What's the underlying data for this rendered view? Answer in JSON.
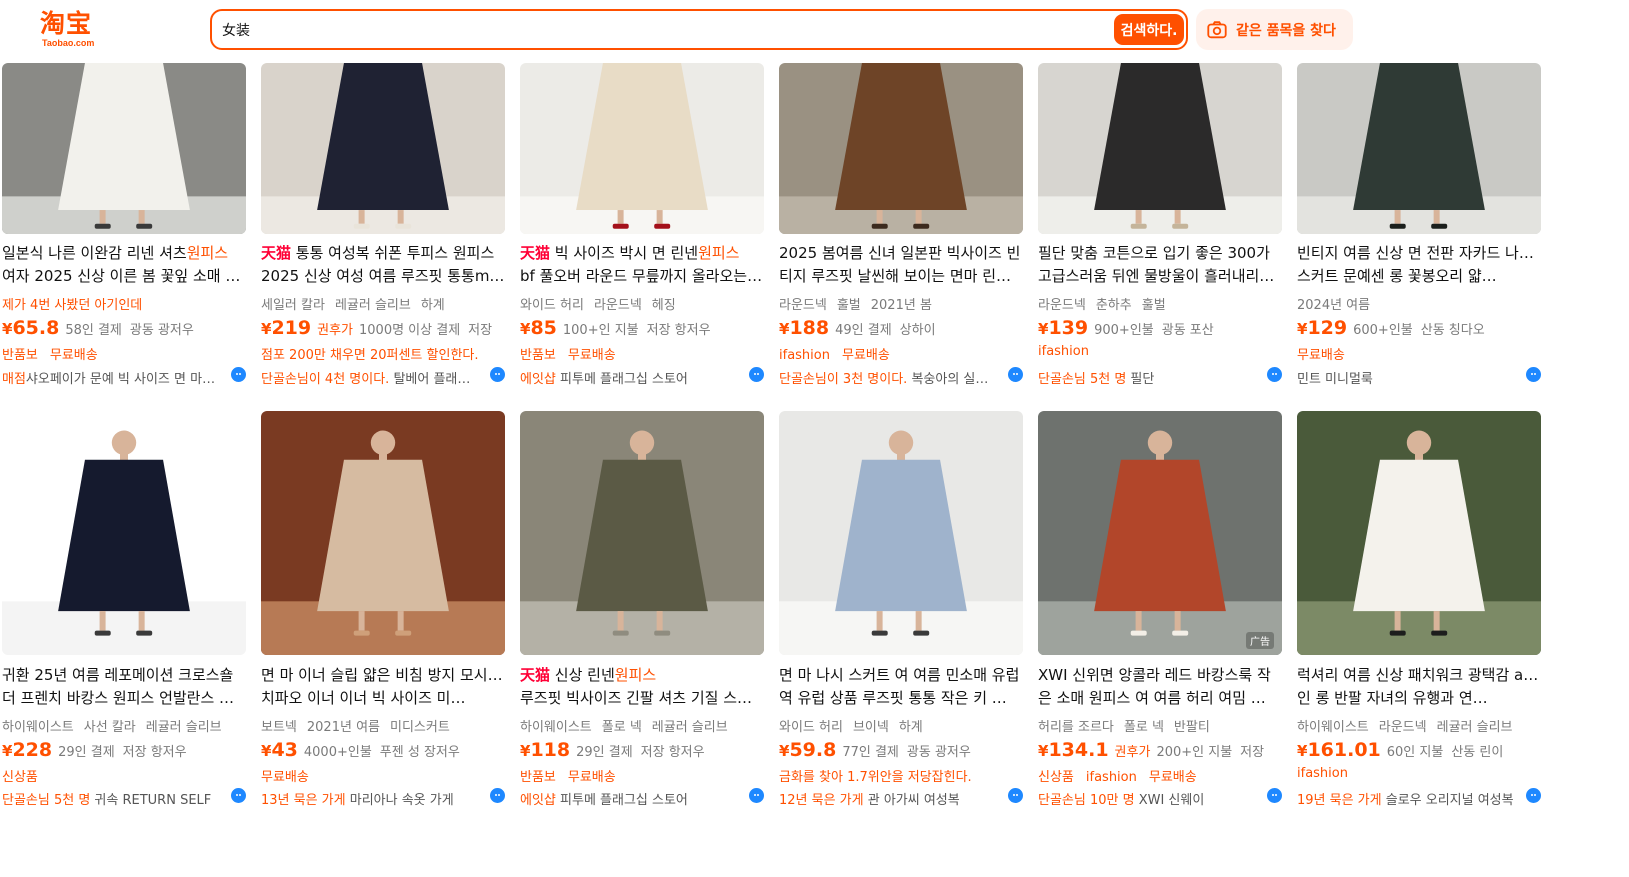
{
  "header": {
    "logo_text": "淘宝",
    "logo_sub": "Taobao.com",
    "search_value": "女装",
    "search_button": "검색하다.",
    "same_item_button": "같은 품목을 찾다"
  },
  "products": [
    {
      "title_prefix": "",
      "title_parts": [
        "일본식 나른 이완감 리넨 셔츠",
        "원피스",
        "여자 2025 신상 이른 봄 꽃잎 소매 …"
      ],
      "tags": [
        "제가 4번 사봤던 아기인데"
      ],
      "tags_warm": true,
      "price": "65.8",
      "after_coupon": "",
      "meta": [
        "58인 결제",
        "광동 광저우"
      ],
      "promos": [
        "반품보",
        "무료배송"
      ],
      "shop_badge": "매점",
      "shop_name": "샤오페이가 문예 빅 사이즈 면 마…"
    },
    {
      "title_prefix": "天猫",
      "title_parts": [
        " 통통 여성복 쉬폰 투피스 원피스",
        "",
        "2025 신상 여성 여름 루즈핏 통통m…"
      ],
      "tags": [
        "세일러 칼라",
        "레귤러 슬리브",
        "하계"
      ],
      "tags_warm": false,
      "price": "219",
      "after_coupon": "권후가",
      "meta": [
        "1000명 이상 결제",
        "저장"
      ],
      "promos": [
        "점포 200만 채우면 20퍼센트 할인한다."
      ],
      "shop_badge": "단골손님이 4천 명이다.",
      "shop_name": " 탈베어 플래…"
    },
    {
      "title_prefix": "天猫",
      "title_parts": [
        " 빅 사이즈 박시 면 린넨",
        "원피스",
        "bf 풀오버 라운드 무릎까지 올라오는 …"
      ],
      "tags": [
        "와이드 허리",
        "라운드넥",
        "헤징"
      ],
      "tags_warm": false,
      "price": "85",
      "after_coupon": "",
      "meta": [
        "100+인 지불",
        "저장 항저우"
      ],
      "promos": [
        "반품보",
        "무료배송"
      ],
      "shop_badge": "에잇샵",
      "shop_name": " 피투메 플래그십 스토어"
    },
    {
      "title_prefix": "",
      "title_parts": [
        "2025 봄여름 신녀 일본판 빅사이즈 빈",
        "",
        "티지 루즈핏 날씬해 보이는 면마 린…"
      ],
      "tags": [
        "라운드넥",
        "훌벌",
        "2021년 봄"
      ],
      "tags_warm": false,
      "price": "188",
      "after_coupon": "",
      "meta": [
        "49인 결제",
        "상하이"
      ],
      "promos": [
        "ifashion",
        "무료배송"
      ],
      "shop_badge": "단골손님이 3천 명이다.",
      "shop_name": " 복숭아의 실…"
    },
    {
      "title_prefix": "",
      "title_parts": [
        "필단 맞춤 코튼으로 입기 좋은 300가",
        "",
        "고급스러움 뒤엔 물방울이 흘러내리…"
      ],
      "tags": [
        "라운드넥",
        "춘하추",
        "훌벌"
      ],
      "tags_warm": false,
      "price": "139",
      "after_coupon": "",
      "meta": [
        "900+인불",
        "광동 포산"
      ],
      "promos": [
        "ifashion"
      ],
      "shop_badge": "단골손님 5천 명",
      "shop_name": " 필단"
    },
    {
      "title_prefix": "",
      "title_parts": [
        "빈티지 여름 신상 면 전판 자카드 나시",
        "원피스",
        "스커트 문예센 롱 꽃봉오리 얇…"
      ],
      "tags": [
        "2024년 여름"
      ],
      "tags_warm": false,
      "price": "129",
      "after_coupon": "",
      "meta": [
        "600+인불",
        "산동 칭다오"
      ],
      "promos": [
        "무료배송"
      ],
      "shop_badge": "",
      "shop_name": "민트 미니멀룩"
    },
    {
      "title_prefix": "",
      "title_parts": [
        "귀환 25년 여름 레포메이션 크로스숄",
        "",
        "더 프렌치 바캉스 원피스 언발란스 …"
      ],
      "tags": [
        "하이웨이스트",
        "사선 칼라",
        "레귤러 슬리브"
      ],
      "tags_warm": false,
      "price": "228",
      "after_coupon": "",
      "meta": [
        "29인 결제",
        "저장 항저우"
      ],
      "promos": [
        "신상품"
      ],
      "shop_badge": "단골손님 5천 명",
      "shop_name": " 귀속 RETURN SELF"
    },
    {
      "title_prefix": "",
      "title_parts": [
        "면 마 이너 슬립 얇은 비침 방지 모시",
        "원피스",
        "치파오 이너 이너 빅 사이즈 미…"
      ],
      "tags": [
        "보트넥",
        "2021년 여름",
        "미디스커트"
      ],
      "tags_warm": false,
      "price": "43",
      "after_coupon": "",
      "meta": [
        "4000+인불",
        "푸젠 성 장저우"
      ],
      "promos": [
        "무료배송"
      ],
      "shop_badge": "13년 묵은 가게",
      "shop_name": " 마리아나 속옷 가게"
    },
    {
      "title_prefix": "天猫",
      "title_parts": [
        " 신상 린넨",
        "원피스",
        "루즈핏 빅사이즈 긴팔 셔츠 기질 스쿨룩 밴딩 하이웨…"
      ],
      "tags": [
        "하이웨이스트",
        "폴로 넥",
        "레귤러 슬리브"
      ],
      "tags_warm": false,
      "price": "118",
      "after_coupon": "",
      "meta": [
        "29인 결제",
        "저장 항저우"
      ],
      "promos": [
        "반품보",
        "무료배송"
      ],
      "shop_badge": "에잇샵",
      "shop_name": " 피투메 플래그십 스토어"
    },
    {
      "title_prefix": "",
      "title_parts": [
        "면 마 나시 스커트 여 여름 민소매 유럽",
        "",
        "역 유럽 상품 루즈핏 통통 작은 키 …"
      ],
      "tags": [
        "와이드 허리",
        "브이넥",
        "하계"
      ],
      "tags_warm": false,
      "price": "59.8",
      "after_coupon": "",
      "meta": [
        "77인 결제",
        "광동 광저우"
      ],
      "promos": [
        "금화를 찾아 1.7위안을 저당잡힌다."
      ],
      "shop_badge": "12년 묵은 가게",
      "shop_name": " 관 아가씨 여성복"
    },
    {
      "title_prefix": "",
      "title_parts": [
        "XWI 신위면 앙콜라 레드 바캉스룩 작",
        "",
        "은 소매 원피스 여 여름 허리 여밈 …"
      ],
      "tags": [
        "허리를 조르다",
        "폴로 넥",
        "반팔티"
      ],
      "tags_warm": false,
      "price": "134.1",
      "after_coupon": "권후가",
      "meta": [
        "200+인 지불",
        "저장"
      ],
      "promos": [
        "신상품",
        "ifashion",
        "무료배송"
      ],
      "shop_badge": "단골손님 10만 명",
      "shop_name": " XWI 신웨이"
    },
    {
      "title_prefix": "",
      "title_parts": [
        "럭셔리 여름 신상 패치워크 광택감 a라",
        "원피스",
        "인 롱 반팔 자녀의 유행과 연…"
      ],
      "tags": [
        "하이웨이스트",
        "라운드넥",
        "레귤러 슬리브"
      ],
      "tags_warm": false,
      "price": "161.01",
      "after_coupon": "",
      "meta": [
        "60인 지불",
        "산동 린이"
      ],
      "promos": [
        "ifashion"
      ],
      "shop_badge": "19년 묵은 가게",
      "shop_name": " 슬로우 오리지널 여성복"
    }
  ],
  "ad_label": "广告",
  "currency": "¥",
  "colors": {
    "accent": "#ff5000",
    "tmall": "#ff0036",
    "chat": "#1e88ff"
  }
}
